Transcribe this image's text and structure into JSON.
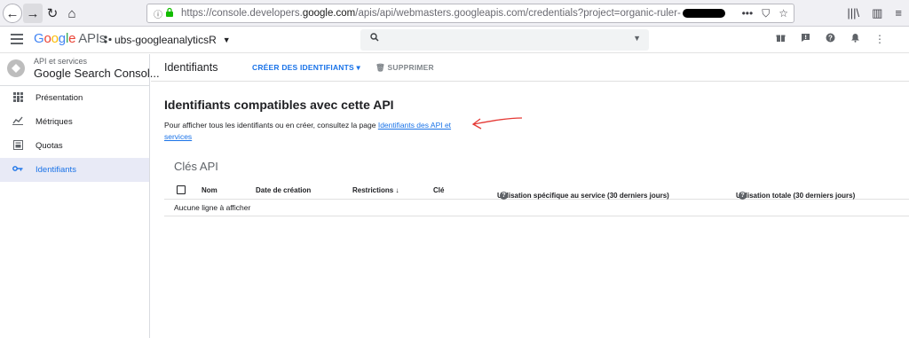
{
  "browser": {
    "url_prefix": "https://console.developers.",
    "url_domain": "google.com",
    "url_suffix": "/apis/api/webmasters.googleapis.com/credentials?project=organic-ruler-",
    "back_icon": "←",
    "forward_icon": "→",
    "reload_icon": "↻",
    "home_icon": "⌂",
    "info_icon": "ⓘ",
    "lock_icon": "🔒",
    "more_icon": "•••",
    "pocket_icon": "⛉",
    "star_icon": "☆",
    "library_icon": "|||\\",
    "sidebar_icon": "▥",
    "menu_icon": "≡"
  },
  "header": {
    "logo_letters": [
      "G",
      "o",
      "o",
      "g",
      "l",
      "e"
    ],
    "logo_suffix": "APIs",
    "project_name": "ubs-googleanalyticsR",
    "search_icon": "🔍",
    "dropdown_icon": "▼",
    "icons": {
      "gift": "🎁",
      "feedback": "❢",
      "help": "?",
      "bell": "🔔",
      "more": "⋮"
    }
  },
  "sidebar": {
    "section_sub": "API et services",
    "section_title": "Google Search Consol...",
    "items": [
      {
        "label": "Présentation",
        "icon": "⁞⁞"
      },
      {
        "label": "Métriques",
        "icon": "📈"
      },
      {
        "label": "Quotas",
        "icon": "▦"
      },
      {
        "label": "Identifiants",
        "icon": "⚷"
      }
    ]
  },
  "page": {
    "title": "Identifiants",
    "create_button": "CRÉER DES IDENTIFIANTS ▾",
    "delete_button": "🗑 SUPPRIMER",
    "section_title": "Identifiants compatibles avec cette API",
    "section_desc": "Pour afficher tous les identifiants ou en créer, consultez la page ",
    "section_link": "Identifiants des API et services",
    "keys_title": "Clés API",
    "table": {
      "columns": [
        "Nom",
        "Date de création",
        "Restrictions ↓",
        "Clé",
        "Utilisation spécifique au service (30 derniers jours)",
        "Utilisation totale (30 derniers jours)"
      ],
      "empty_message": "Aucune ligne à afficher"
    }
  },
  "colors": {
    "accent": "#1a73e8",
    "annotation_arrow": "#e53935"
  }
}
